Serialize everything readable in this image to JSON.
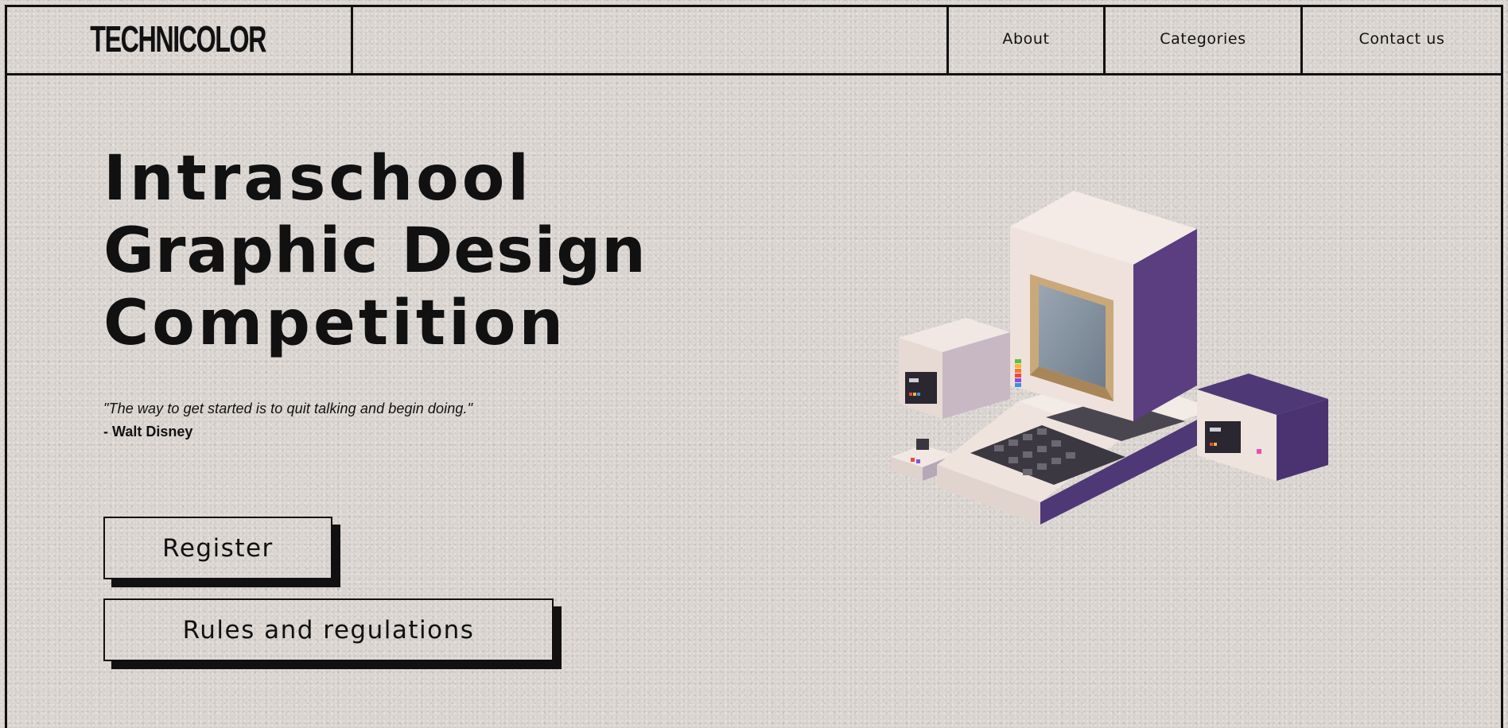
{
  "brand": {
    "logo_text": "TECHNICOLOR"
  },
  "nav": {
    "items": [
      {
        "label": "About"
      },
      {
        "label": "Categories"
      },
      {
        "label": "Contact us"
      }
    ]
  },
  "hero": {
    "line1": "Intraschool",
    "line2": "Graphic Design",
    "line3": "Competition",
    "quote": "\"The way to get started is to quit talking and begin doing.\"",
    "author": "- Walt Disney"
  },
  "actions": {
    "register_label": "Register",
    "rules_label": "Rules and regulations"
  },
  "illustration": {
    "name": "retro-computer-illustration"
  },
  "colors": {
    "background": "#d9d4d0",
    "ink": "#111111",
    "computer_cream": "#ece0da",
    "computer_purple": "#5b3f82"
  }
}
